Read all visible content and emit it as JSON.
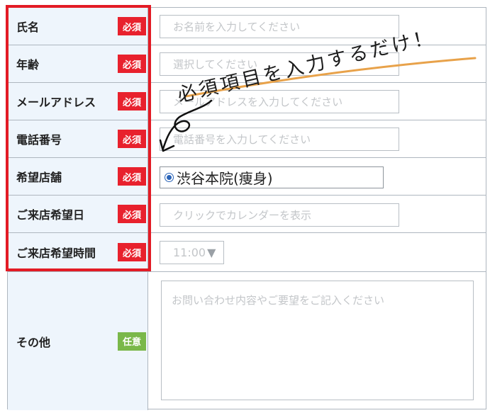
{
  "rows": [
    {
      "label": "氏名",
      "badge": "必須",
      "placeholder": "お名前を入力してください"
    },
    {
      "label": "年齢",
      "badge": "必須",
      "placeholder": "選択してください"
    },
    {
      "label": "メールアドレス",
      "badge": "必須",
      "placeholder": "メールアドレスを入力してください"
    },
    {
      "label": "電話番号",
      "badge": "必須",
      "placeholder": "電話番号を入力してください"
    },
    {
      "label": "希望店舗",
      "badge": "必須",
      "selected_store": "渋谷本院(痩身)"
    },
    {
      "label": "ご来店希望日",
      "badge": "必須",
      "placeholder": "クリックでカレンダーを表示"
    },
    {
      "label": "ご来店希望時間",
      "badge": "必須",
      "time_value": "11:00",
      "arrow": "▼"
    },
    {
      "label": "その他",
      "badge": "任意",
      "placeholder": "お問い合わせ内容やご要望をご記入ください"
    }
  ],
  "annotation": {
    "text": "必須項目を入力するだけ！"
  },
  "colors": {
    "required_badge": "#e8212d",
    "optional_badge": "#7ab84a",
    "label_background": "#eef5fc",
    "highlight_frame": "#e31b25",
    "annotation_underline": "#e8a24a"
  }
}
